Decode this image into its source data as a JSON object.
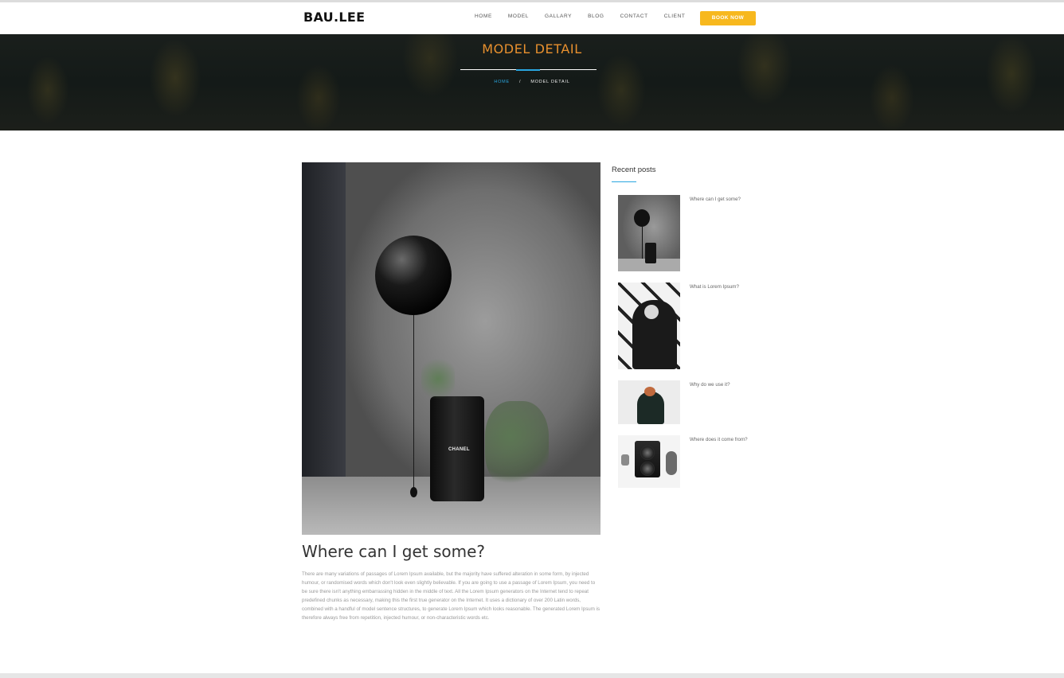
{
  "header": {
    "logo": "BAU.LEE",
    "nav": [
      "HOME",
      "MODEL",
      "GALLARY",
      "BLOG",
      "CONTACT",
      "CLIENT"
    ],
    "book_button": "BOOK NOW",
    "accent_color": "#f7b81e"
  },
  "hero": {
    "title": "MODEL DETAIL",
    "title_color": "#e8902e",
    "breadcrumb": {
      "home": "HOME",
      "separator": "/",
      "current": "MODEL DETAIL"
    }
  },
  "article": {
    "image_alt": "black-balloon-chanel-barrel-photo",
    "barrel_label": "CHANEL",
    "title": "Where can I get some?",
    "body": "There are many variations of passages of Lorem Ipsum available, but the majority have suffered alteration in some form, by injected humour, or randomised words which don't look even slightly believable. If you are going to use a passage of Lorem Ipsum, you need to be sure there isn't anything embarrassing hidden in the middle of text. All the Lorem Ipsum generators on the Internet tend to repeat predefined chunks as necessary, making this the first true generator on the Internet. It uses a dictionary of over 200 Latin words, combined with a handful of model sentence structures, to generate Lorem Ipsum which looks reasonable. The generated Lorem Ipsum is therefore always free from repetition, injected humour, or non-characteristic words etc."
  },
  "sidebar": {
    "title": "Recent posts",
    "posts": [
      {
        "title": "Where can I get some?"
      },
      {
        "title": "What is Lorem Ipsum?"
      },
      {
        "title": "Why do we use it?"
      },
      {
        "title": "Where does it come from?"
      }
    ]
  }
}
